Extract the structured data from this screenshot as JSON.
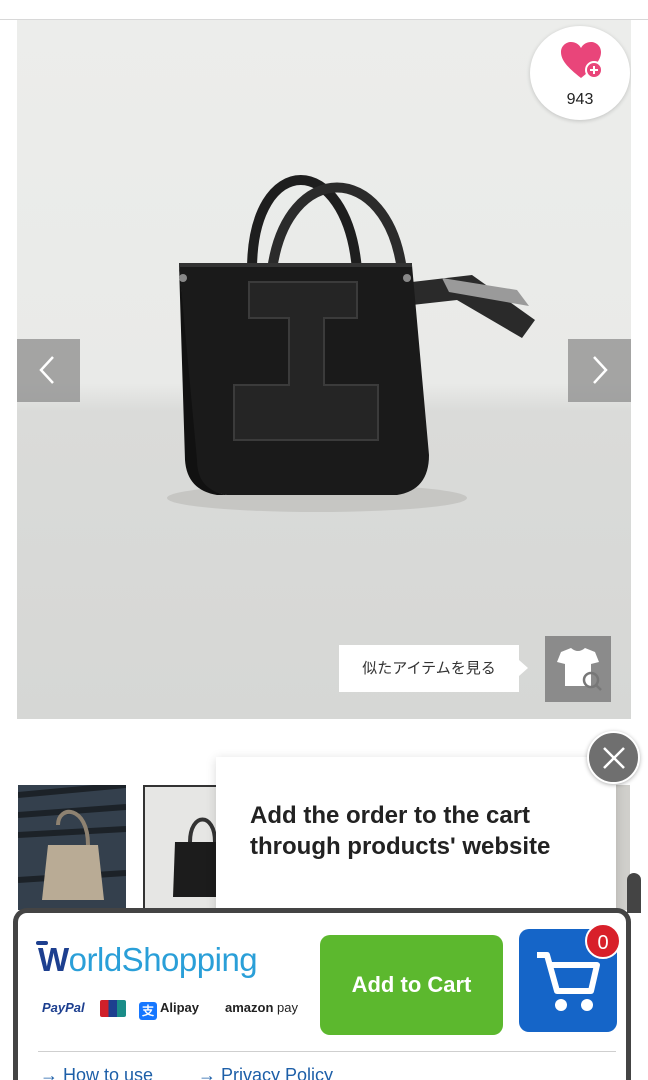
{
  "favorite": {
    "count": "943",
    "icon": "heart-plus-icon",
    "color": "#e9457a"
  },
  "gallery": {
    "prev_icon": "chevron-left-icon",
    "next_icon": "chevron-right-icon",
    "similar_label": "似たアイテムを見る",
    "similar_icon": "shirt-search-icon"
  },
  "popup": {
    "message": "Add the order to the cart through products' website",
    "close_icon": "close-icon"
  },
  "worldshopping": {
    "logo_w": "W",
    "logo_rest": "orldShopping",
    "payments": {
      "paypal": "PayPal",
      "unionpay_icon": "unionpay-icon",
      "alipay": "Alipay",
      "amazon": "amazon",
      "amazon_pay": "pay"
    },
    "add_to_cart_label": "Add to Cart",
    "cart_icon": "cart-icon",
    "cart_count": "0",
    "links": {
      "how_to_use": "How to use",
      "privacy_policy": "Privacy Policy"
    },
    "colors": {
      "green": "#5cb82e",
      "blue": "#1565c8",
      "badge": "#d8202a"
    }
  }
}
